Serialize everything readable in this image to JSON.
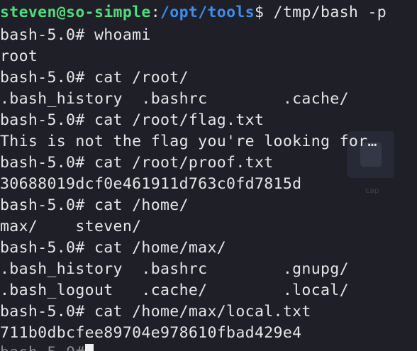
{
  "prompt": {
    "user_host": "steven@so-simple",
    "colon": ":",
    "path": "/opt/tools",
    "suffix": "$ /tmp/bash -p"
  },
  "lines": [
    "bash-5.0# whoami",
    "root",
    "bash-5.0# cat /root/",
    ".bash_history  .bashrc        .cache/",
    "bash-5.0# cat /root/flag.txt",
    "This is not the flag you're looking for…",
    "bash-5.0# cat /root/proof.txt",
    "30688019dcf0e461911d763c0fd7815d",
    "bash-5.0# cat /home/",
    "max/    steven/",
    "bash-5.0# cat /home/max/",
    ".bash_history  .bashrc        .gnupg/",
    ".bash_logout   .cache/        .local/",
    "bash-5.0# cat /home/max/local.txt",
    "711b0dbcfee89704e978610fbad429e4"
  ],
  "current_prompt": "bash-5.0#",
  "desktop_icon_label": "cap"
}
